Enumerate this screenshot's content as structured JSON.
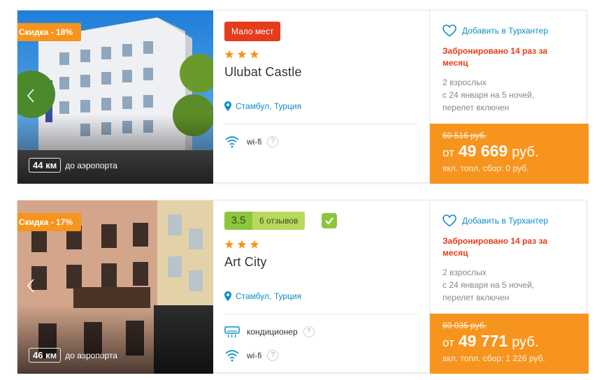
{
  "colors": {
    "accent": "#f7941d",
    "link": "#0a8fc7",
    "alert": "#e53c1b",
    "rating": "#8cc63f"
  },
  "hotels": [
    {
      "discount": "Скидка - 18%",
      "badge": "Мало мест",
      "stars": 3,
      "name": "Ulubat Castle",
      "location": "Стамбул, Турция",
      "amenities": [
        {
          "icon": "wifi-icon",
          "label": "wi-fi"
        }
      ],
      "distance_km": "44 км",
      "distance_label": "до аэропорта",
      "favorite": "Добавить в Турхантер",
      "booked": "Забронировано 14 раз за месяц",
      "details": [
        "2 взрослых",
        "с 24 января на 5 ночей,",
        "перелет включен"
      ],
      "old_price": "60 516 руб.",
      "from": "от",
      "price": "49 669",
      "currency": "руб.",
      "fee": "вкл. топл. сбор: 0 руб."
    },
    {
      "discount": "Скидка - 17%",
      "rating": "3.5",
      "reviews": "6 отзывов",
      "stars": 3,
      "name": "Art City",
      "location": "Стамбул, Турция",
      "amenities": [
        {
          "icon": "air-conditioner-icon",
          "label": "кондиционер"
        },
        {
          "icon": "wifi-icon",
          "label": "wi-fi"
        }
      ],
      "distance_km": "46 км",
      "distance_label": "до аэропорта",
      "favorite": "Добавить в Турхантер",
      "booked": "Забронировано 14 раз за месяц",
      "details": [
        "2 взрослых",
        "с 24 января на 5 ночей,",
        "перелет включен"
      ],
      "old_price": "60 035 руб.",
      "from": "от",
      "price": "49 771",
      "currency": "руб.",
      "fee": "вкл. топл. сбор: 1 226 руб."
    }
  ],
  "amenity_help": "?"
}
